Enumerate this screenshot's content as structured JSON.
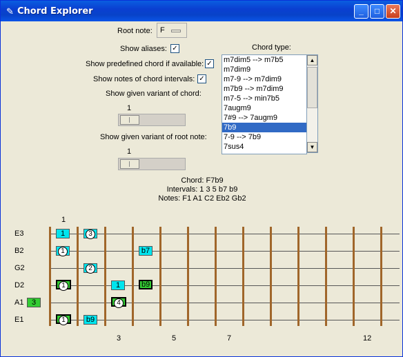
{
  "window": {
    "title": "Chord Explorer"
  },
  "controls": {
    "root_note_label": "Root note:",
    "root_note_value": "F",
    "show_aliases_label": "Show aliases:",
    "show_aliases_checked": "✓",
    "show_predefined_label": "Show predefined chord if available:",
    "show_predefined_checked": "✓",
    "show_notes_label": "Show notes of chord intervals:",
    "show_notes_checked": "✓",
    "variant_chord_label": "Show given variant of chord:",
    "variant_chord_value": "1",
    "variant_root_label": "Show given variant of root note:",
    "variant_root_value": "1",
    "chord_type_label": "Chord type:"
  },
  "chord_types": [
    "m7dim5 --> m7b5",
    "m7dim9",
    "m7-9 --> m7dim9",
    "m7b9 --> m7dim9",
    "m7-5 --> min7b5",
    "7augm9",
    "7#9 --> 7augm9",
    "7b9",
    "7-9 --> 7b9",
    "7sus4"
  ],
  "info": {
    "chord": "Chord: F7b9",
    "intervals": "Intervals: 1 3 5 b7 b9",
    "notes": "Notes: F1 A1 C2 Eb2 Gb2"
  },
  "fretboard": {
    "top_label": "1",
    "strings": [
      "E3",
      "B2",
      "G2",
      "D2",
      "A1",
      "E1"
    ],
    "fret_numbers": [
      "3",
      "5",
      "7",
      "12"
    ],
    "notes": {
      "e3_1": "1",
      "e3_2": "3",
      "b2_1": "1",
      "b2_4": "b7",
      "g2_2": "2",
      "d2_1": "1",
      "d2_3": "1",
      "d2_4": "b9",
      "a1_0": "3",
      "a1_3": "4",
      "e1_1": "1",
      "e1_2": "b9"
    }
  }
}
